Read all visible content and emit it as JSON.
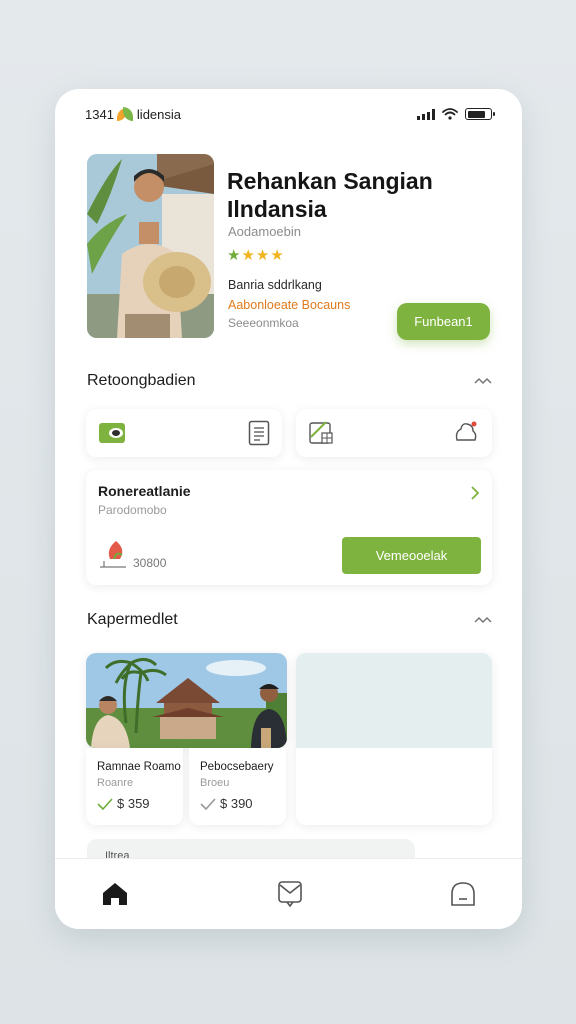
{
  "status_bar": {
    "time": "1341",
    "brand": "lidensia",
    "battery_level": 0.8
  },
  "hero": {
    "title": "Rehankan Sangian Ilndansia",
    "subtitle": "Aodamoebin",
    "rating": 4,
    "rating_max": 4,
    "line1": "Banria sddrlkang",
    "line2": "Aabonloeate Bocauns",
    "line3": "Seeeonmkoa",
    "button_label": "Funbean1",
    "accent_color": "#7fb33f",
    "highlight_color": "#e17a1c"
  },
  "section1": {
    "title": "Retoongbadien",
    "icons": [
      "wallet-icon",
      "document-icon",
      "calendar-icon",
      "bell-icon"
    ]
  },
  "offer": {
    "title": "Ronereatlanie",
    "subtitle": "Parodomobo",
    "price": "30800",
    "button_label": "Vemeooelak"
  },
  "section2": {
    "title": "Kapermedlet",
    "listings": [
      {
        "name": "Ramnae Roamo",
        "sub": "Roanre",
        "price": "$ 359"
      },
      {
        "name": "Pebocsebaery",
        "sub": "Broeu",
        "price": "$ 390"
      }
    ]
  },
  "peek": {
    "label": "Iltrea"
  },
  "nav": {
    "items": [
      "home-icon",
      "inbox-icon",
      "profile-icon"
    ]
  }
}
